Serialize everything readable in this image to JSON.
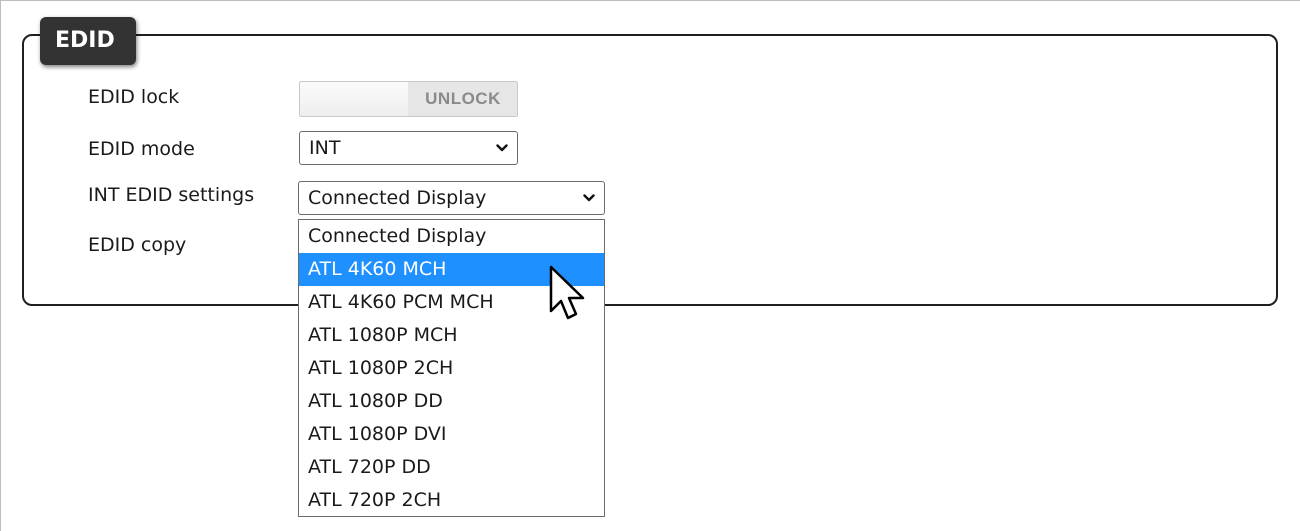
{
  "panel": {
    "title": "EDID"
  },
  "rows": {
    "lock": {
      "label": "EDID lock",
      "toggle_text": "UNLOCK"
    },
    "mode": {
      "label": "EDID mode",
      "value": "INT"
    },
    "int_settings": {
      "label": "INT EDID settings",
      "value": "Connected Display"
    },
    "copy": {
      "label": "EDID copy"
    }
  },
  "dropdown": {
    "selected_index": 1,
    "options": [
      "Connected Display",
      "ATL 4K60 MCH",
      "ATL 4K60 PCM MCH",
      "ATL 1080P MCH",
      "ATL 1080P 2CH",
      "ATL 1080P DD",
      "ATL 1080P DVI",
      "ATL 720P DD",
      "ATL 720P 2CH"
    ]
  },
  "colors": {
    "highlight": "#1e90ff",
    "tab_background": "#333333"
  },
  "icons": {
    "select_arrow": "chevron-down-icon",
    "cursor": "mouse-pointer-icon"
  }
}
